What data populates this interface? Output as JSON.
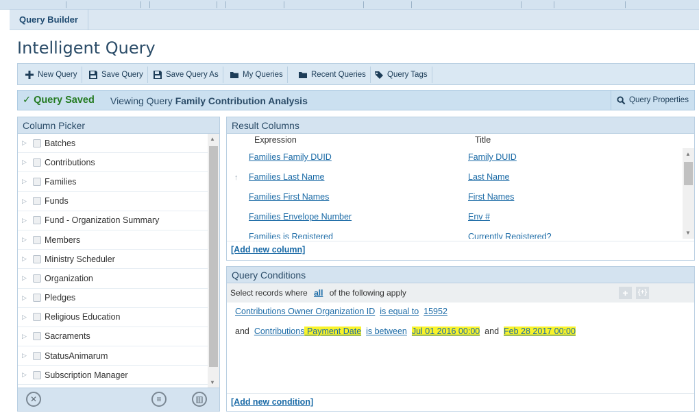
{
  "subnav": {
    "tab_label": "Query Builder"
  },
  "page_title": "Intelligent Query",
  "toolbar": {
    "buttons": [
      {
        "label": "New Query",
        "icon": "plus-icon"
      },
      {
        "label": "Save Query",
        "icon": "save-icon"
      },
      {
        "label": "Save Query As",
        "icon": "save-icon"
      },
      {
        "label": "My Queries",
        "icon": "folder-icon"
      },
      {
        "label": "Recent Queries",
        "icon": "folder-icon"
      },
      {
        "label": "Query Tags",
        "icon": "tag-icon"
      }
    ]
  },
  "status": {
    "check": "✓",
    "saved": "Query Saved",
    "viewing_prefix": "Viewing Query",
    "query_name": "Family Contribution Analysis",
    "properties_label": "Query Properties"
  },
  "column_picker": {
    "title": "Column Picker",
    "items": [
      "Batches",
      "Contributions",
      "Families",
      "Funds",
      "Fund - Organization Summary",
      "Members",
      "Ministry Scheduler",
      "Organization",
      "Pledges",
      "Religious Education",
      "Sacraments",
      "StatusAnimarum",
      "Subscription Manager"
    ]
  },
  "result_columns": {
    "title": "Result Columns",
    "headers": {
      "expression": "Expression",
      "title": "Title"
    },
    "rows": [
      {
        "expression": "Families Family DUID",
        "title": "Family DUID"
      },
      {
        "expression": "Families Last Name",
        "title": "Last Name"
      },
      {
        "expression": "Families First Names",
        "title": "First Names"
      },
      {
        "expression": "Families Envelope Number",
        "title": "Env #"
      },
      {
        "expression": "Families is Registered",
        "title": "Currently Registered?"
      }
    ],
    "add_label": "[Add new column]"
  },
  "conditions": {
    "title": "Query Conditions",
    "select_prefix": "Select records where",
    "select_scope": "all",
    "select_suffix": "of the following apply",
    "line1": {
      "field": "Contributions Owner Organization ID",
      "op": "is equal to",
      "value": "15952"
    },
    "line2": {
      "conj": "and",
      "field_prefix": "Contributions",
      "field_hl": " Payment Date",
      "op": "is between",
      "v1": "Jul 01 2016 00:00",
      "and2": "and",
      "v2": "Feb 28 2017 00:00"
    },
    "add_label": "[Add new condition]"
  },
  "colors": {
    "link": "#1a6aa6",
    "saved_green": "#237a20",
    "highlight": "#f8f32a",
    "panel_head": "#d4e3f0"
  }
}
